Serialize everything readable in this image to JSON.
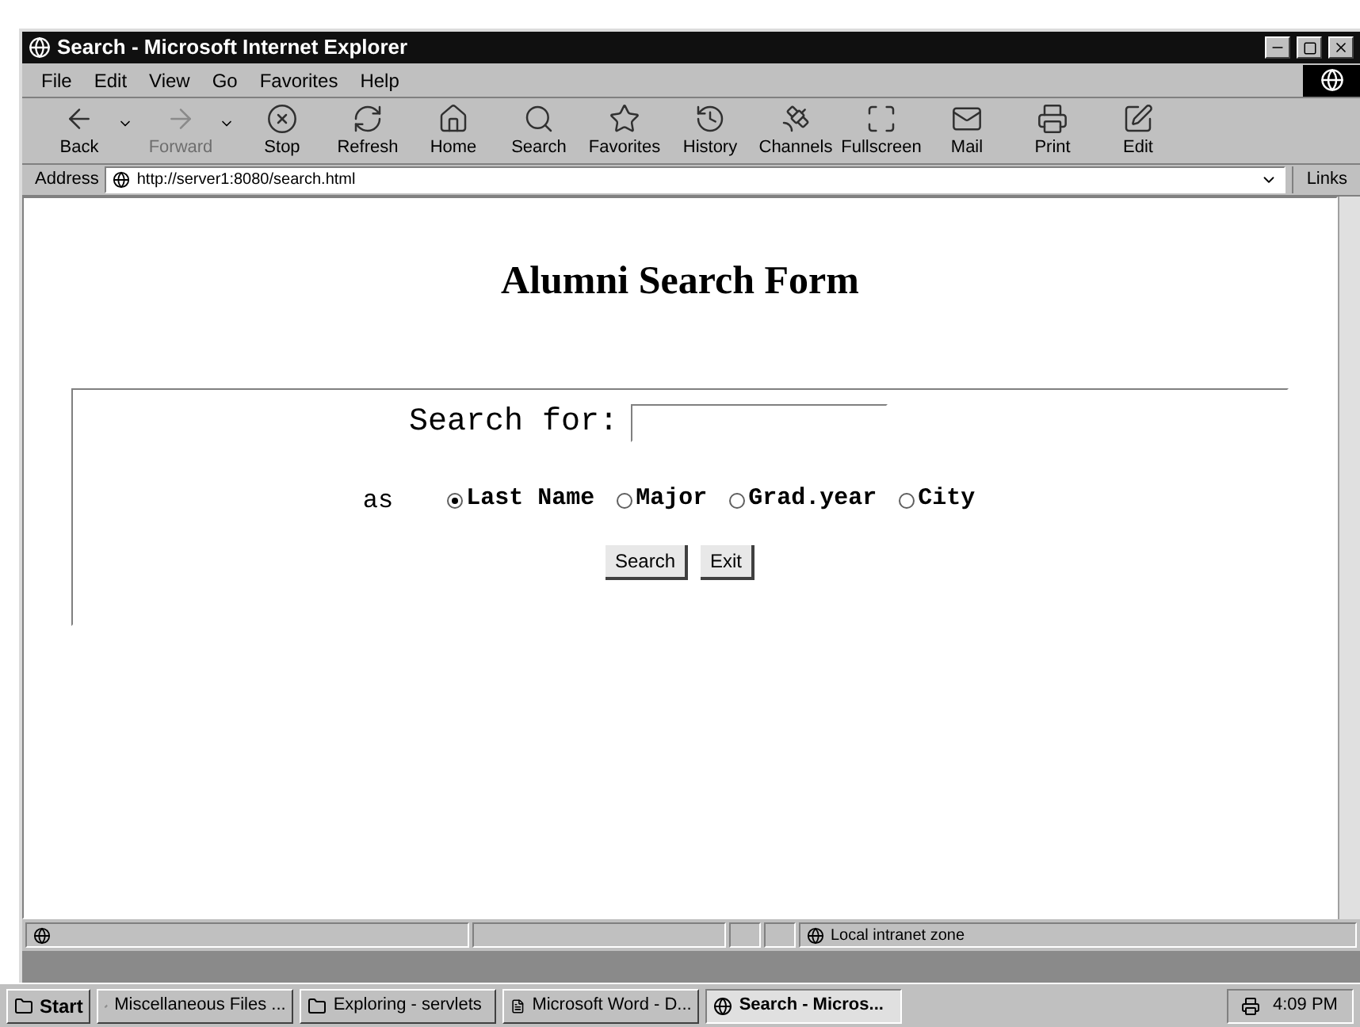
{
  "window": {
    "title": "Search - Microsoft Internet Explorer"
  },
  "menu": [
    "File",
    "Edit",
    "View",
    "Go",
    "Favorites",
    "Help"
  ],
  "toolbar": [
    {
      "label": "Back",
      "disabled": false,
      "dropdown": true
    },
    {
      "label": "Forward",
      "disabled": true,
      "dropdown": true
    },
    {
      "label": "Stop",
      "disabled": false,
      "dropdown": false
    },
    {
      "label": "Refresh",
      "disabled": false,
      "dropdown": false
    },
    {
      "label": "Home",
      "disabled": false,
      "dropdown": false
    },
    {
      "label": "Search",
      "disabled": false,
      "dropdown": false
    },
    {
      "label": "Favorites",
      "disabled": false,
      "dropdown": false
    },
    {
      "label": "History",
      "disabled": false,
      "dropdown": false
    },
    {
      "label": "Channels",
      "disabled": false,
      "dropdown": false
    },
    {
      "label": "Fullscreen",
      "disabled": false,
      "dropdown": false
    },
    {
      "label": "Mail",
      "disabled": false,
      "dropdown": false
    },
    {
      "label": "Print",
      "disabled": false,
      "dropdown": false
    },
    {
      "label": "Edit",
      "disabled": false,
      "dropdown": false
    }
  ],
  "address": {
    "label": "Address",
    "value": "http://server1:8080/search.html",
    "links": "Links"
  },
  "page": {
    "heading": "Alumni Search Form",
    "search_label": "Search for:",
    "as_label": "as",
    "options": [
      {
        "label": "Last Name",
        "selected": true
      },
      {
        "label": "Major",
        "selected": false
      },
      {
        "label": "Grad.year",
        "selected": false
      },
      {
        "label": "City",
        "selected": false
      }
    ],
    "buttons": [
      "Search",
      "Exit"
    ]
  },
  "status_bar": {
    "zone": "Local intranet zone"
  },
  "taskbar": {
    "start": "Start",
    "tasks": [
      {
        "label": "Miscellaneous Files ...",
        "selected": false
      },
      {
        "label": "Exploring - servlets",
        "selected": false
      },
      {
        "label": "Microsoft Word - D...",
        "selected": false
      },
      {
        "label": "Search - Micros...",
        "selected": true
      }
    ],
    "clock": "4:09 PM"
  }
}
